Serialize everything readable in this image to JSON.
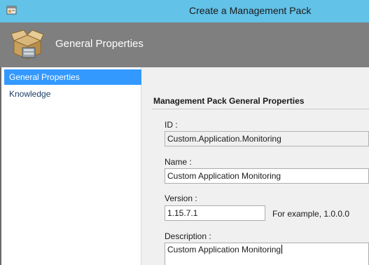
{
  "window": {
    "title": "Create a Management Pack"
  },
  "header": {
    "title": "General Properties"
  },
  "nav": {
    "items": [
      {
        "label": "General Properties",
        "selected": true
      },
      {
        "label": "Knowledge",
        "selected": false
      }
    ]
  },
  "form": {
    "section_title": "Management Pack General Properties",
    "id_label": "ID :",
    "id_value": "Custom.Application.Monitoring",
    "name_label": "Name :",
    "name_value": "Custom Application Monitoring",
    "version_label": "Version :",
    "version_value": "1.15.7.1",
    "version_hint": "For example, 1.0.0.0",
    "description_label": "Description :",
    "description_value": "Custom Application Monitoring"
  },
  "colors": {
    "titlebar": "#63c2e8",
    "banner": "#7f7f7f",
    "selection": "#3399ff"
  }
}
